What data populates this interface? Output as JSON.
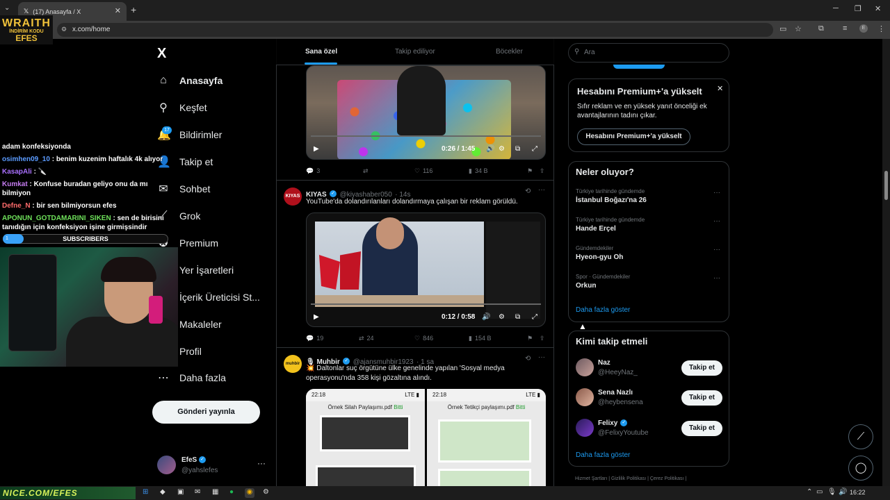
{
  "browser": {
    "tab_title": "(17) Anasayfa / X",
    "url": "x.com/home",
    "new_tab": "+",
    "tab_close": "✕"
  },
  "overlay": {
    "logo_line1": "WRAITH",
    "logo_line2": "İNDİRİM KODU",
    "logo_line3": "EFES",
    "chat": [
      {
        "user": "",
        "user_color": "#ffffff",
        "text": "adam konfeksiyonda"
      },
      {
        "user": "osimhen09_10",
        "user_color": "#5b9bff",
        "text": " : benim kuzenim haftalık 4k alıyor"
      },
      {
        "user": "KasapAli",
        "user_color": "#a970ff",
        "text": " : 🔪"
      },
      {
        "user": "Kumkat",
        "user_color": "#c57cf0",
        "text": " : Konfuse buradan geliyo onu da mı bilmiyon"
      },
      {
        "user": "Defne_N",
        "user_color": "#ff6b6b",
        "text": " : bir sen bilmiyorsun efes"
      },
      {
        "user": "APONUN_GOTDAMARINI_SIKEN",
        "user_color": "#6ee05a",
        "text": " : sen de birisini tanıdığın için konfeksiyon işine girmişsindir"
      }
    ],
    "subscribers_count": "1",
    "subscribers_label": "SUBSCRIBERS",
    "taskbar_banner": "NICE.COM/EFES"
  },
  "nav": {
    "logo": "X",
    "badge": "17",
    "items": [
      {
        "label": "Anasayfa",
        "icon": "home-icon"
      },
      {
        "label": "Keşfet",
        "icon": "search-icon"
      },
      {
        "label": "Bildirimler",
        "icon": "bell-icon"
      },
      {
        "label": "Takip et",
        "icon": "follow-icon"
      },
      {
        "label": "Sohbet",
        "icon": "chat-icon"
      },
      {
        "label": "Grok",
        "icon": "grok-icon"
      },
      {
        "label": "Premium",
        "icon": "premium-icon"
      },
      {
        "label": "Yer İşaretleri",
        "icon": "bookmark-icon"
      },
      {
        "label": "İçerik Üreticisi St...",
        "icon": "creator-icon"
      },
      {
        "label": "Makaleler",
        "icon": "article-icon"
      },
      {
        "label": "Profil",
        "icon": "profile-icon"
      },
      {
        "label": "Daha fazla",
        "icon": "more-icon"
      }
    ],
    "post_button": "Gönderi yayınla",
    "profile_name": "EfeS",
    "profile_handle": "@yahslefes",
    "profile_more": "···"
  },
  "feed": {
    "tabs": [
      "Sana özel",
      "Takip ediliyor",
      "Böcekler"
    ],
    "post1": {
      "video_time": "0:26 / 1:45",
      "replies": "3",
      "reposts": "",
      "likes": "116",
      "views": "34 B"
    },
    "post2": {
      "name": "KIYAS",
      "avatar_text": "KIYAS",
      "handle": "@kiyashaber050",
      "time": "· 14s",
      "text": "YouTube'da dolandırılanları dolandırmaya çalışan bir reklam görüldü.",
      "video_time": "0:12 / 0:58",
      "replies": "19",
      "reposts": "24",
      "likes": "846",
      "views": "154 B"
    },
    "post3": {
      "name": "Muhbir",
      "avatar_text": "muhbir",
      "handle": "@ajansmuhbir1923",
      "time": "· 1 sa",
      "text": "💥 Daltonlar suç örgütüne ülke genelinde yapılan 'Sosyal medya operasyonu'nda 358 kişi gözaltına alındı.",
      "img1_time": "22:18",
      "img1_title": "Örnek Silah Paylaşımı.pdf",
      "img1_done": "Bitti",
      "img2_time": "22:18",
      "img2_title": "Örnek Tetikçi paylaşımı.pdf",
      "img2_done": "Bitti"
    }
  },
  "right": {
    "search_placeholder": "Ara",
    "premium": {
      "title": "Hesabını Premium+'a yükselt",
      "desc": "Sıfır reklam ve en yüksek yanıt önceliği ek avantajlarının tadını çıkar.",
      "button": "Hesabını Premium+'a yükselt",
      "close": "✕"
    },
    "trends": {
      "title": "Neler oluyor?",
      "items": [
        {
          "context": "Türkiye tarihinde gündemde",
          "name": "İstanbul Boğazı'na 26"
        },
        {
          "context": "Türkiye tarihinde gündemde",
          "name": "Hande Erçel"
        },
        {
          "context": "Gündemdekiler",
          "name": "Hyeon-gyu Oh"
        },
        {
          "context": "Spor · Gündemdekiler",
          "name": "Orkun"
        }
      ],
      "more": "Daha fazla göster"
    },
    "follow": {
      "title": "Kimi takip etmeli",
      "items": [
        {
          "name": "Naz",
          "handle": "@HeeyNaz_",
          "button": "Takip et",
          "verified": false
        },
        {
          "name": "Sena Nazlı",
          "handle": "@heybensena",
          "button": "Takip et",
          "verified": false
        },
        {
          "name": "Felixy",
          "handle": "@FelixyYoutube",
          "button": "Takip et",
          "verified": true
        }
      ],
      "more": "Daha fazla göster"
    },
    "footer": "Hizmet Şartları  |  Gizlilik Politikası  |  Çerez Politikası  |"
  },
  "taskbar": {
    "clock": "16:22"
  },
  "colors": {
    "accent": "#1d9bf0",
    "background": "#000000",
    "border": "#2f3336"
  }
}
